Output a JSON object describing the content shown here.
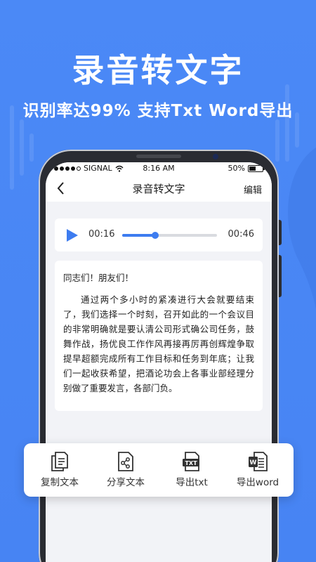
{
  "promo": {
    "title": "录音转文字",
    "subtitle": "识别率达99%  支持Txt  Word导出"
  },
  "status_bar": {
    "carrier": "SIGNAL",
    "time": "8:16 AM",
    "battery": "50%"
  },
  "nav": {
    "title": "录音转文字",
    "edit_label": "编辑"
  },
  "player": {
    "current_time": "00:16",
    "total_time": "00:46",
    "progress_fraction": 0.35
  },
  "transcript": {
    "greeting": "同志们！朋友们！",
    "body": "通过两个多小时的紧凑进行大会就要结束了，我们选择一个时刻，召开如此的一个会议目的非常明确就是要认清公司形式确公司任务，鼓舞作战，扬优良工作作风再接再厉再创辉煌争取提早超额完成所有工作目标和任务到年底；让我们一起收获希望，把酒论功会上各事业部经理分别做了重要发言，各部门负。"
  },
  "actions": [
    {
      "label": "复制文本",
      "icon": "copy-document-icon"
    },
    {
      "label": "分享文本",
      "icon": "share-document-icon"
    },
    {
      "label": "导出txt",
      "icon": "txt-file-icon"
    },
    {
      "label": "导出word",
      "icon": "word-file-icon"
    }
  ],
  "colors": {
    "background": "#4a86f4",
    "accent": "#3d7cf0",
    "panel": "#ffffff"
  }
}
